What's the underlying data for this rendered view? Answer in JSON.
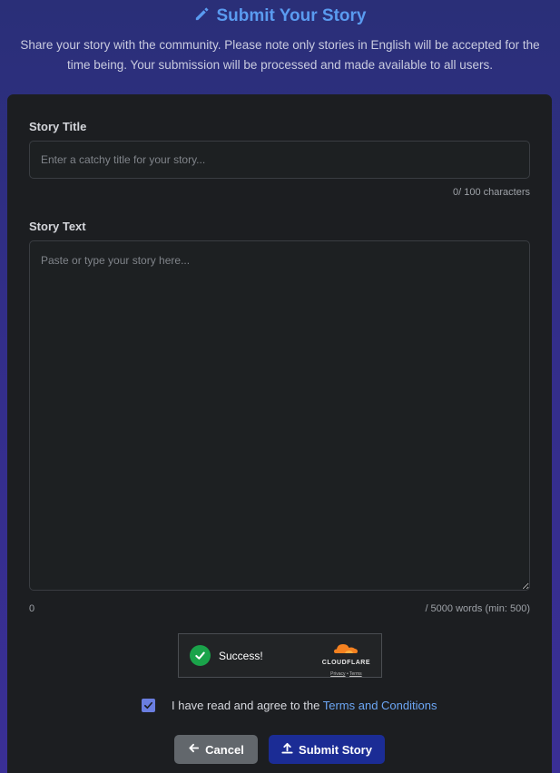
{
  "header": {
    "title": "Submit Your Story",
    "subtitle": "Share your story with the community. Please note only stories in English will be accepted for the time being. Your submission will be processed and made available to all users.",
    "title_icon": "pencil-icon"
  },
  "form": {
    "title_label": "Story Title",
    "title_value": "",
    "title_placeholder": "Enter a catchy title for your story...",
    "title_counter": "0/ 100 characters",
    "text_label": "Story Text",
    "text_value": "",
    "text_placeholder": "Paste or type your story here...",
    "word_count": "0",
    "word_limit": "/ 5000 words (min: 500)"
  },
  "captcha": {
    "status": "Success!",
    "brand": "CLOUDFLARE",
    "privacy_link": "Privacy",
    "separator": "•",
    "terms_link": "Terms"
  },
  "agreement": {
    "checked": true,
    "text": "I have read and agree to the ",
    "link": "Terms and Conditions"
  },
  "buttons": {
    "cancel_label": "Cancel",
    "submit_label": "Submit Story"
  },
  "colors": {
    "accent": "#5a9bf0",
    "card_bg": "#1c1e21",
    "submit_bg": "#1b2c95",
    "cancel_bg": "#62676c",
    "success": "#1aa34a",
    "cloudflare_orange": "#f48120"
  }
}
